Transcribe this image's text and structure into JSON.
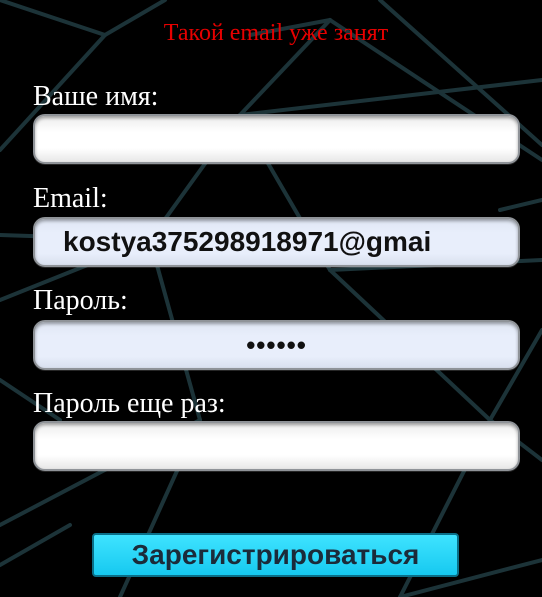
{
  "error_message": "Такой email уже занят",
  "colors": {
    "background": "#000000",
    "error": "#e60000",
    "button": "#16c9f0",
    "lines": "#1c3338"
  },
  "form": {
    "name": {
      "label": "Ваше имя:",
      "value": ""
    },
    "email": {
      "label": "Email:",
      "value": "kostya375298918971@gmai"
    },
    "password": {
      "label": "Пароль:",
      "value": "••••••"
    },
    "password_repeat": {
      "label": "Пароль еще раз:",
      "value": ""
    }
  },
  "submit_label": "Зарегистрироваться"
}
